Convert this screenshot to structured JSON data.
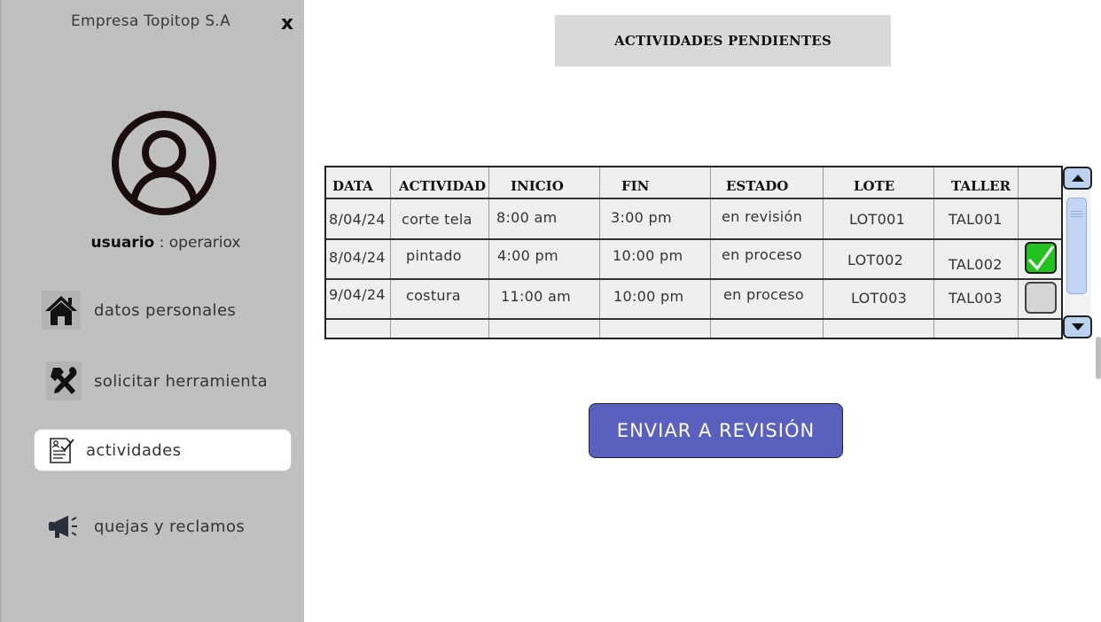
{
  "sidebar": {
    "company": "Empresa Topitop S.A",
    "close_glyph": "x",
    "user_label": "usuario",
    "user_separator": " : ",
    "user_name": "operariox",
    "icons": [
      "close-icon",
      "user-avatar-icon",
      "home-icon",
      "tools-icon",
      "checklist-document-icon",
      "megaphone-icon"
    ],
    "items": [
      {
        "label": "datos personales",
        "icon": "home-icon"
      },
      {
        "label": "solicitar herramienta",
        "icon": "tools-icon"
      },
      {
        "label": "actividades",
        "icon": "checklist-document-icon",
        "selected": true
      },
      {
        "label": "quejas y reclamos",
        "icon": "megaphone-icon"
      }
    ]
  },
  "main": {
    "title": "ACTIVIDADES PENDIENTES",
    "table": {
      "headers": [
        "DATA",
        "ACTIVIDAD",
        "INICIO",
        "FIN",
        "ESTADO",
        "LOTE",
        "TALLER"
      ],
      "rows": [
        {
          "data": "8/04/24",
          "actividad": "corte tela",
          "inicio": "8:00 am",
          "fin": "3:00 pm",
          "estado": "en revisión",
          "lote": "LOT001",
          "taller": "TAL001",
          "checkbox": "none"
        },
        {
          "data": "8/04/24",
          "actividad": "pintado",
          "inicio": "4:00 pm",
          "fin": "10:00 pm",
          "estado": "en proceso",
          "lote": "LOT002",
          "taller": "TAL002",
          "checkbox": "checked"
        },
        {
          "data": "9/04/24",
          "actividad": "costura",
          "inicio": "11:00 am",
          "fin": "10:00 pm",
          "estado": "en proceso",
          "lote": "LOT003",
          "taller": "TAL003",
          "checkbox": "unchecked"
        }
      ]
    },
    "submit_label": "ENVIAR A REVISIÓN"
  },
  "colors": {
    "sidebar_bg": "#c0c0c0",
    "title_bg": "#d9d9d9",
    "button_bg": "#5a60bd",
    "checkbox_checked": "#22c21e",
    "scrollbar": "#bcd3ef"
  }
}
